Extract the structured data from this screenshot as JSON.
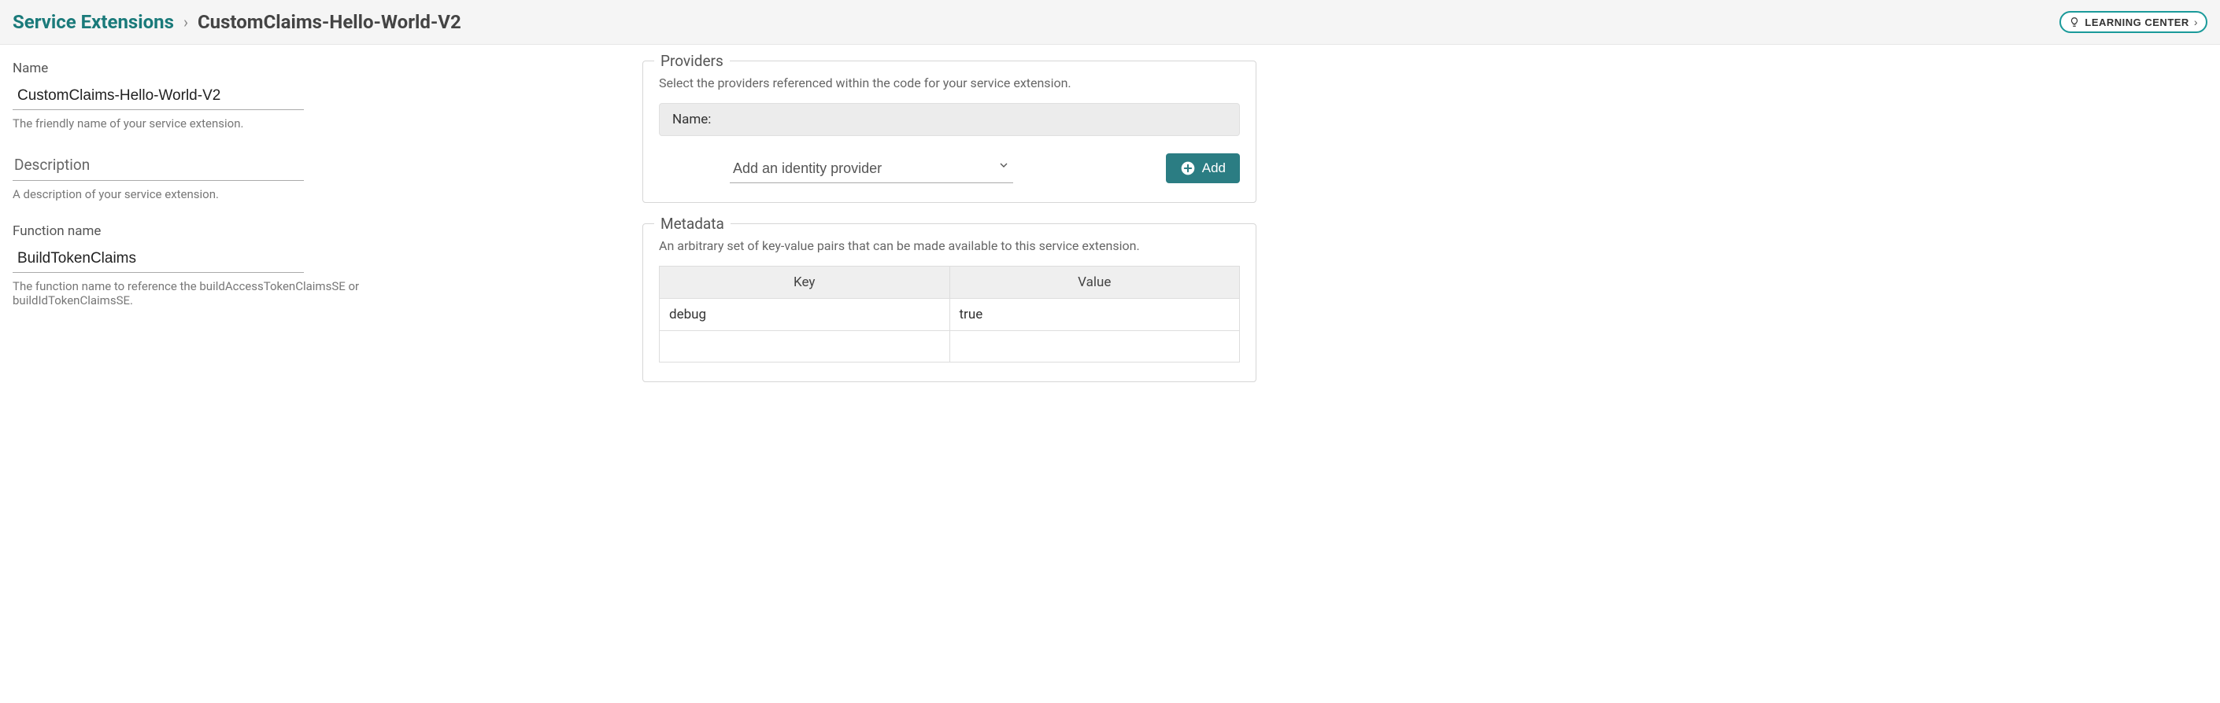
{
  "header": {
    "breadcrumb_root": "Service Extensions",
    "breadcrumb_sep": "›",
    "breadcrumb_current": "CustomClaims-Hello-World-V2",
    "learning_center_label": "LEARNING CENTER"
  },
  "left": {
    "name": {
      "label": "Name",
      "value": "CustomClaims-Hello-World-V2",
      "help": "The friendly name of your service extension."
    },
    "description": {
      "label": "Description",
      "value": "",
      "help": "A description of your service extension."
    },
    "function_name": {
      "label": "Function name",
      "value": "BuildTokenClaims",
      "help": "The function name to reference the buildAccessTokenClaimsSE or buildIdTokenClaimsSE."
    }
  },
  "right": {
    "providers": {
      "legend": "Providers",
      "description": "Select the providers referenced within the code for your service extension.",
      "name_bar": "Name:",
      "select_placeholder": "Add an identity provider",
      "add_label": "Add"
    },
    "metadata": {
      "legend": "Metadata",
      "description": "An arbitrary set of key-value pairs that can be made available to this service extension.",
      "columns": {
        "key": "Key",
        "value": "Value"
      },
      "rows": [
        {
          "key": "debug",
          "value": "true"
        },
        {
          "key": "",
          "value": ""
        }
      ]
    }
  }
}
